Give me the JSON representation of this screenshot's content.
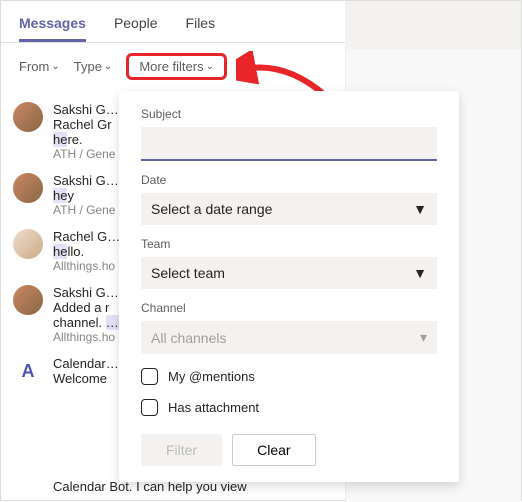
{
  "tabs": {
    "messages": "Messages",
    "people": "People",
    "files": "Files"
  },
  "filters": {
    "from": "From",
    "type": "Type",
    "more": "More filters"
  },
  "list": [
    {
      "sender": "Sakshi Garg",
      "preview_pre": "Rachel Gr",
      "hl": "",
      "preview_post": "",
      "preview2_pre": "",
      "preview2_hl": "he",
      "preview2_post": "re.",
      "sub": "ATH / Gene",
      "avatar": "p1"
    },
    {
      "sender": "Sakshi Garg",
      "preview_pre": "",
      "hl": "he",
      "preview_post": "y",
      "sub": "ATH / Gene",
      "avatar": "p1"
    },
    {
      "sender": "Rachel Gree",
      "preview_pre": "",
      "hl": "he",
      "preview_post": "llo.",
      "sub": "Allthings.ho",
      "avatar": "p2"
    },
    {
      "sender": "Sakshi Garg",
      "preview_pre": "Added a r",
      "hl": "",
      "preview_post": "",
      "preview2_pre": "channel. ",
      "preview2_hl": "He",
      "preview2_post": "",
      "sub": "Allthings.ho",
      "avatar": "p1"
    },
    {
      "sender": "Calendar BO",
      "preview_pre": "Welcome",
      "hl": "",
      "preview_post": "",
      "sub": "",
      "avatar": "bot"
    }
  ],
  "bottom_line": "Calendar Bot. I can help you view",
  "panel": {
    "subject_label": "Subject",
    "date_label": "Date",
    "date_placeholder": "Select a date range",
    "team_label": "Team",
    "team_placeholder": "Select team",
    "channel_label": "Channel",
    "channel_placeholder": "All channels",
    "mentions": "My @mentions",
    "attachment": "Has attachment",
    "filter_btn": "Filter",
    "clear_btn": "Clear"
  }
}
